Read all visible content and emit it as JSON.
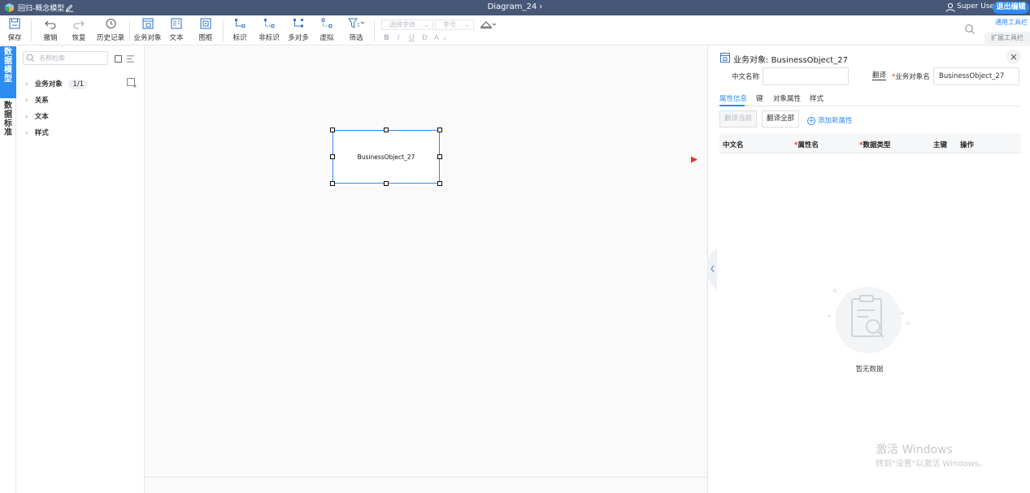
{
  "topbar": {
    "app_title": "回归-概念模型",
    "diagram_title": "Diagram_24",
    "user_name": "Super User",
    "exit_label": "退出编辑"
  },
  "toolbar": {
    "save": "保存",
    "undo": "撤销",
    "redo": "恢复",
    "history": "历史记录",
    "business_object": "业务对象",
    "text": "文本",
    "frame": "图框",
    "identify": "标识",
    "non_identify": "非标识",
    "many_to_many": "多对多",
    "virtual": "虚拟",
    "filter": "筛选",
    "font_placeholder": "选择字体",
    "size_placeholder": "字号",
    "fmt_bold": "B",
    "fmt_italic": "I",
    "fmt_underline": "U",
    "fmt_strike": "Đ",
    "fmt_color": "A",
    "general_toolbar": "通用工具栏",
    "extended_toolbar": "扩展工具栏"
  },
  "left_tabs": [
    "数据模型",
    "数据标准"
  ],
  "tree": {
    "search_placeholder": "名称检索",
    "items": [
      {
        "label": "业务对象",
        "count": "1/1"
      },
      {
        "label": "关系"
      },
      {
        "label": "文本"
      },
      {
        "label": "样式"
      }
    ]
  },
  "canvas": {
    "entity_name": "BusinessObject_27"
  },
  "panel": {
    "title_prefix": "业务对象: ",
    "title_name": "BusinessObject_27",
    "cn_name_label": "中文名称",
    "cn_name_value": "",
    "translate": "翻译",
    "bo_name_label": "业务对象名",
    "bo_name_value": "BusinessObject_27",
    "tabs": [
      "属性信息",
      "键",
      "对象属性",
      "样式"
    ],
    "btn_translate_current": "翻译当前",
    "btn_translate_all": "翻译全部",
    "add_attribute": "添加新属性",
    "columns": [
      "中文名",
      "属性名",
      "数据类型",
      "主键",
      "操作"
    ],
    "empty_text": "暂无数据"
  },
  "watermark": {
    "line1": "激活 Windows",
    "line2": "转到\"设置\"以激活 Windows。"
  },
  "colors": {
    "topbar": "#465777",
    "accent": "#2d8cf0",
    "arrow": "#e8332a"
  }
}
